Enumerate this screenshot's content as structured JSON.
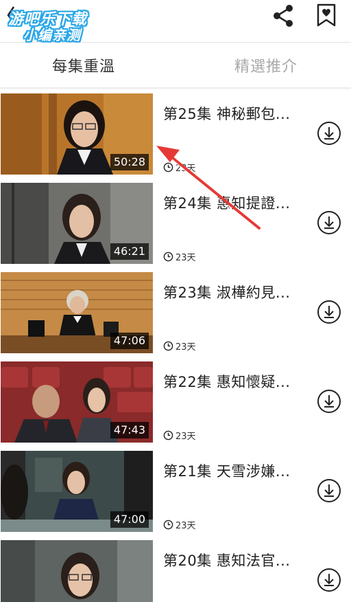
{
  "header": {
    "logo_line1": "游吧乐下载",
    "logo_line2": "小编亲测",
    "back_icon": "chevron-left-icon",
    "share_icon": "share-icon",
    "favorite_icon": "bookmark-heart-icon"
  },
  "tabs": [
    {
      "label": "每集重溫",
      "active": true
    },
    {
      "label": "精選推介",
      "active": false
    }
  ],
  "episodes": [
    {
      "title": "第25集 神秘郵包...",
      "duration": "50:28",
      "age": "23天"
    },
    {
      "title": "第24集 惠知提證...",
      "duration": "46:21",
      "age": "23天"
    },
    {
      "title": "第23集 淑樺約見...",
      "duration": "47:06",
      "age": "23天"
    },
    {
      "title": "第22集 惠知懷疑...",
      "duration": "47:43",
      "age": "23天"
    },
    {
      "title": "第21集 天雪涉嫌...",
      "duration": "47:00",
      "age": "23天"
    },
    {
      "title": "第20集 惠知法官...",
      "duration": "",
      "age": ""
    }
  ],
  "colors": {
    "logo_outline": "#2aa7e8",
    "annotation_arrow": "#e53935",
    "tab_inactive": "#a9a9a9"
  }
}
